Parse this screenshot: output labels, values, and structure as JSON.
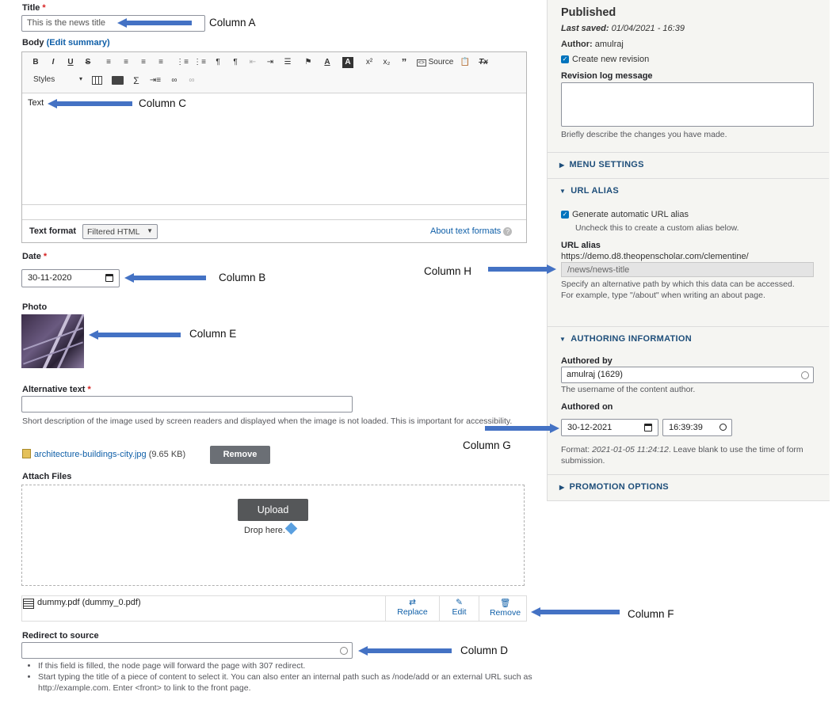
{
  "title_field": {
    "label": "Title",
    "required": "*",
    "value": "This is the news title"
  },
  "body_field": {
    "label": "Body",
    "edit_summary": "(Edit summary)",
    "toolbar_row1": [
      "B",
      "I",
      "U",
      "S",
      "≡",
      "≡",
      "≡",
      "≡",
      "⋮≡",
      "⋮≡",
      "¶",
      "¶",
      "⇤",
      "⇥",
      "☰",
      "⚑",
      "A",
      "A",
      "x²",
      "x₂",
      "”",
      "Source",
      "📋",
      "Tx"
    ],
    "styles_label": "Styles",
    "source_label": "Source",
    "content": "Text",
    "text_format_label": "Text format",
    "text_format_value": "Filtered HTML",
    "about_formats": "About text formats"
  },
  "date_field": {
    "label": "Date",
    "required": "*",
    "value": "30-11-2020"
  },
  "photo_field": {
    "label": "Photo"
  },
  "alt_text": {
    "label": "Alternative text",
    "required": "*",
    "value": "",
    "description": "Short description of the image used by screen readers and displayed when the image is not loaded. This is important for accessibility."
  },
  "file": {
    "name": "architecture-buildings-city.jpg",
    "size": "(9.65 KB)",
    "remove_label": "Remove"
  },
  "attach": {
    "label": "Attach Files",
    "upload_label": "Upload",
    "drop_text": "Drop here."
  },
  "attached_file": {
    "name": "dummy.pdf (dummy_0.pdf)",
    "replace": "Replace",
    "edit": "Edit",
    "remove": "Remove"
  },
  "redirect": {
    "label": "Redirect to source",
    "value": "",
    "bullet1": "If this field is filled, the node page will forward the page with 307 redirect.",
    "bullet2": "Start typing the title of a piece of content to select it. You can also enter an internal path such as /node/add or an external URL such as http://example.com. Enter <front> to link to the front page."
  },
  "sidebar": {
    "status": "Published",
    "last_saved_label": "Last saved:",
    "last_saved_value": "01/04/2021 - 16:39",
    "author_label": "Author:",
    "author_value": "amulraj",
    "new_revision": "Create new revision",
    "revision_label": "Revision log message",
    "revision_desc": "Briefly describe the changes you have made.",
    "menu_settings": "MENU SETTINGS",
    "url_alias": "URL ALIAS",
    "auto_alias": "Generate automatic URL alias",
    "auto_alias_desc": "Uncheck this to create a custom alias below.",
    "url_alias_label": "URL alias",
    "url_prefix": "https://demo.d8.theopenscholar.com/clementine/",
    "url_value": "/news/news-title",
    "url_desc": "Specify an alternative path by which this data can be accessed. For example, type \"/about\" when writing an about page.",
    "authoring_info": "AUTHORING INFORMATION",
    "authored_by_label": "Authored by",
    "authored_by_value": "amulraj (1629)",
    "authored_by_desc": "The username of the content author.",
    "authored_on_label": "Authored on",
    "authored_on_date": "30-12-2021",
    "authored_on_time": "16:39:39",
    "format_prefix": "Format:",
    "format_example": "2021-01-05 11:24:12",
    "format_suffix": ". Leave blank to use the time of form submission.",
    "promotion": "PROMOTION OPTIONS"
  },
  "annotations": {
    "a": "Column A",
    "b": "Column B",
    "c": "Column C",
    "d": "Column D",
    "e": "Column E",
    "f": "Column F",
    "g": "Column G",
    "h": "Column  H"
  },
  "colors": {
    "accent": "#0074bd",
    "arrow": "#4472c4",
    "section_title": "#1e4e7a"
  }
}
